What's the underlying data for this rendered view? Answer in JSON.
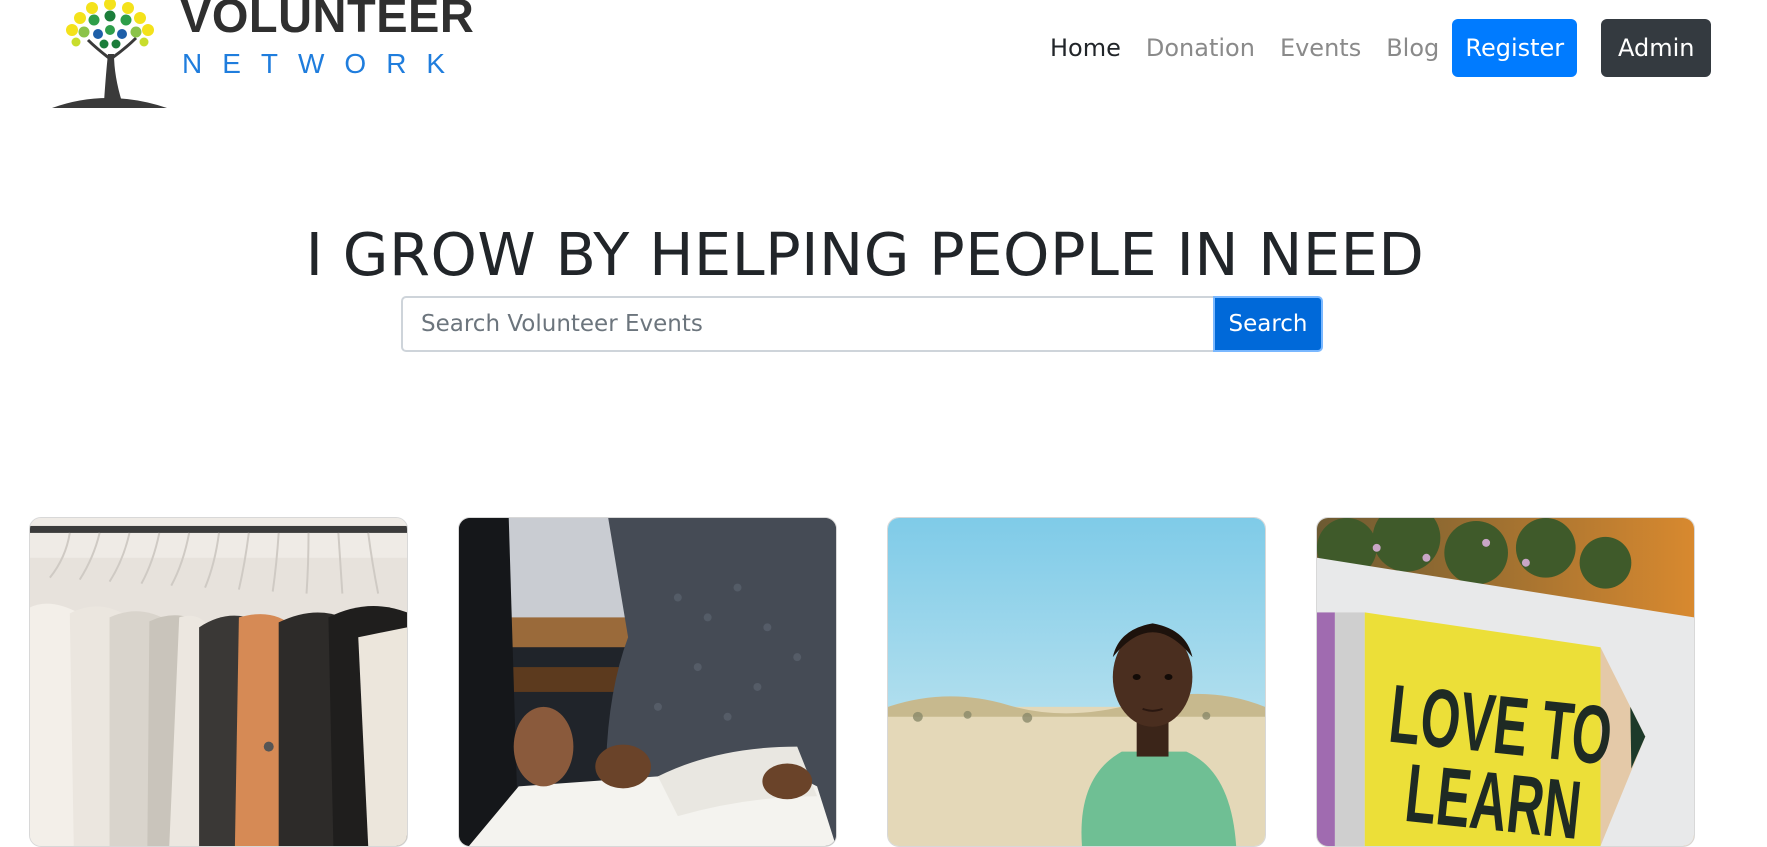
{
  "brand": {
    "title": "VOLUNTEER",
    "subtitle": "NETWORK"
  },
  "nav": {
    "links": [
      "Home",
      "Donation",
      "Events",
      "Blog"
    ],
    "register_label": "Register",
    "admin_label": "Admin"
  },
  "hero": {
    "title": "I GROW BY HELPING PEOPLE IN NEED"
  },
  "search": {
    "placeholder": "Search Volunteer Events",
    "button_label": "Search"
  },
  "cards": [
    {
      "image": "clothing-rack"
    },
    {
      "image": "reading-book"
    },
    {
      "image": "child-portrait"
    },
    {
      "image": "love-to-learn-sign",
      "sign_text": [
        "LOVE TO",
        "LEARN"
      ]
    }
  ],
  "colors": {
    "primary": "#007bff",
    "dark": "#343a40",
    "brand_blue": "#1f7ddd"
  }
}
